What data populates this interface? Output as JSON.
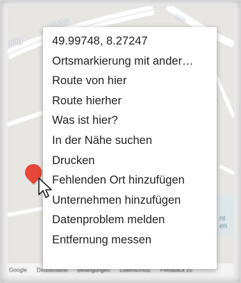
{
  "map": {
    "road_label_left": "eilig",
    "road_label_top": "asse",
    "road_label_right": "tera",
    "side_text_1": "nt",
    "side_text_2": "en",
    "footer_links": [
      "Google",
      "Deutschland",
      "Bedingungen",
      "Datenschutz",
      "Feedback zu"
    ]
  },
  "context_menu": {
    "items": [
      "49.99748, 8.27247",
      "Ortsmarkierung mit ander…",
      "Route von hier",
      "Route hierher",
      "Was ist hier?",
      "In der Nähe suchen",
      "Drucken",
      "Fehlenden Ort hinzufügen",
      "Unternehmen hinzufügen",
      "Datenproblem melden",
      "Entfernung messen"
    ]
  },
  "colors": {
    "marker": "#e6473a",
    "menu_text": "#222222",
    "map_bg": "#e8e6e3",
    "road": "#ffffff"
  },
  "icons": {
    "cursor": "arrow-cursor-icon",
    "marker": "map-pin-icon"
  }
}
